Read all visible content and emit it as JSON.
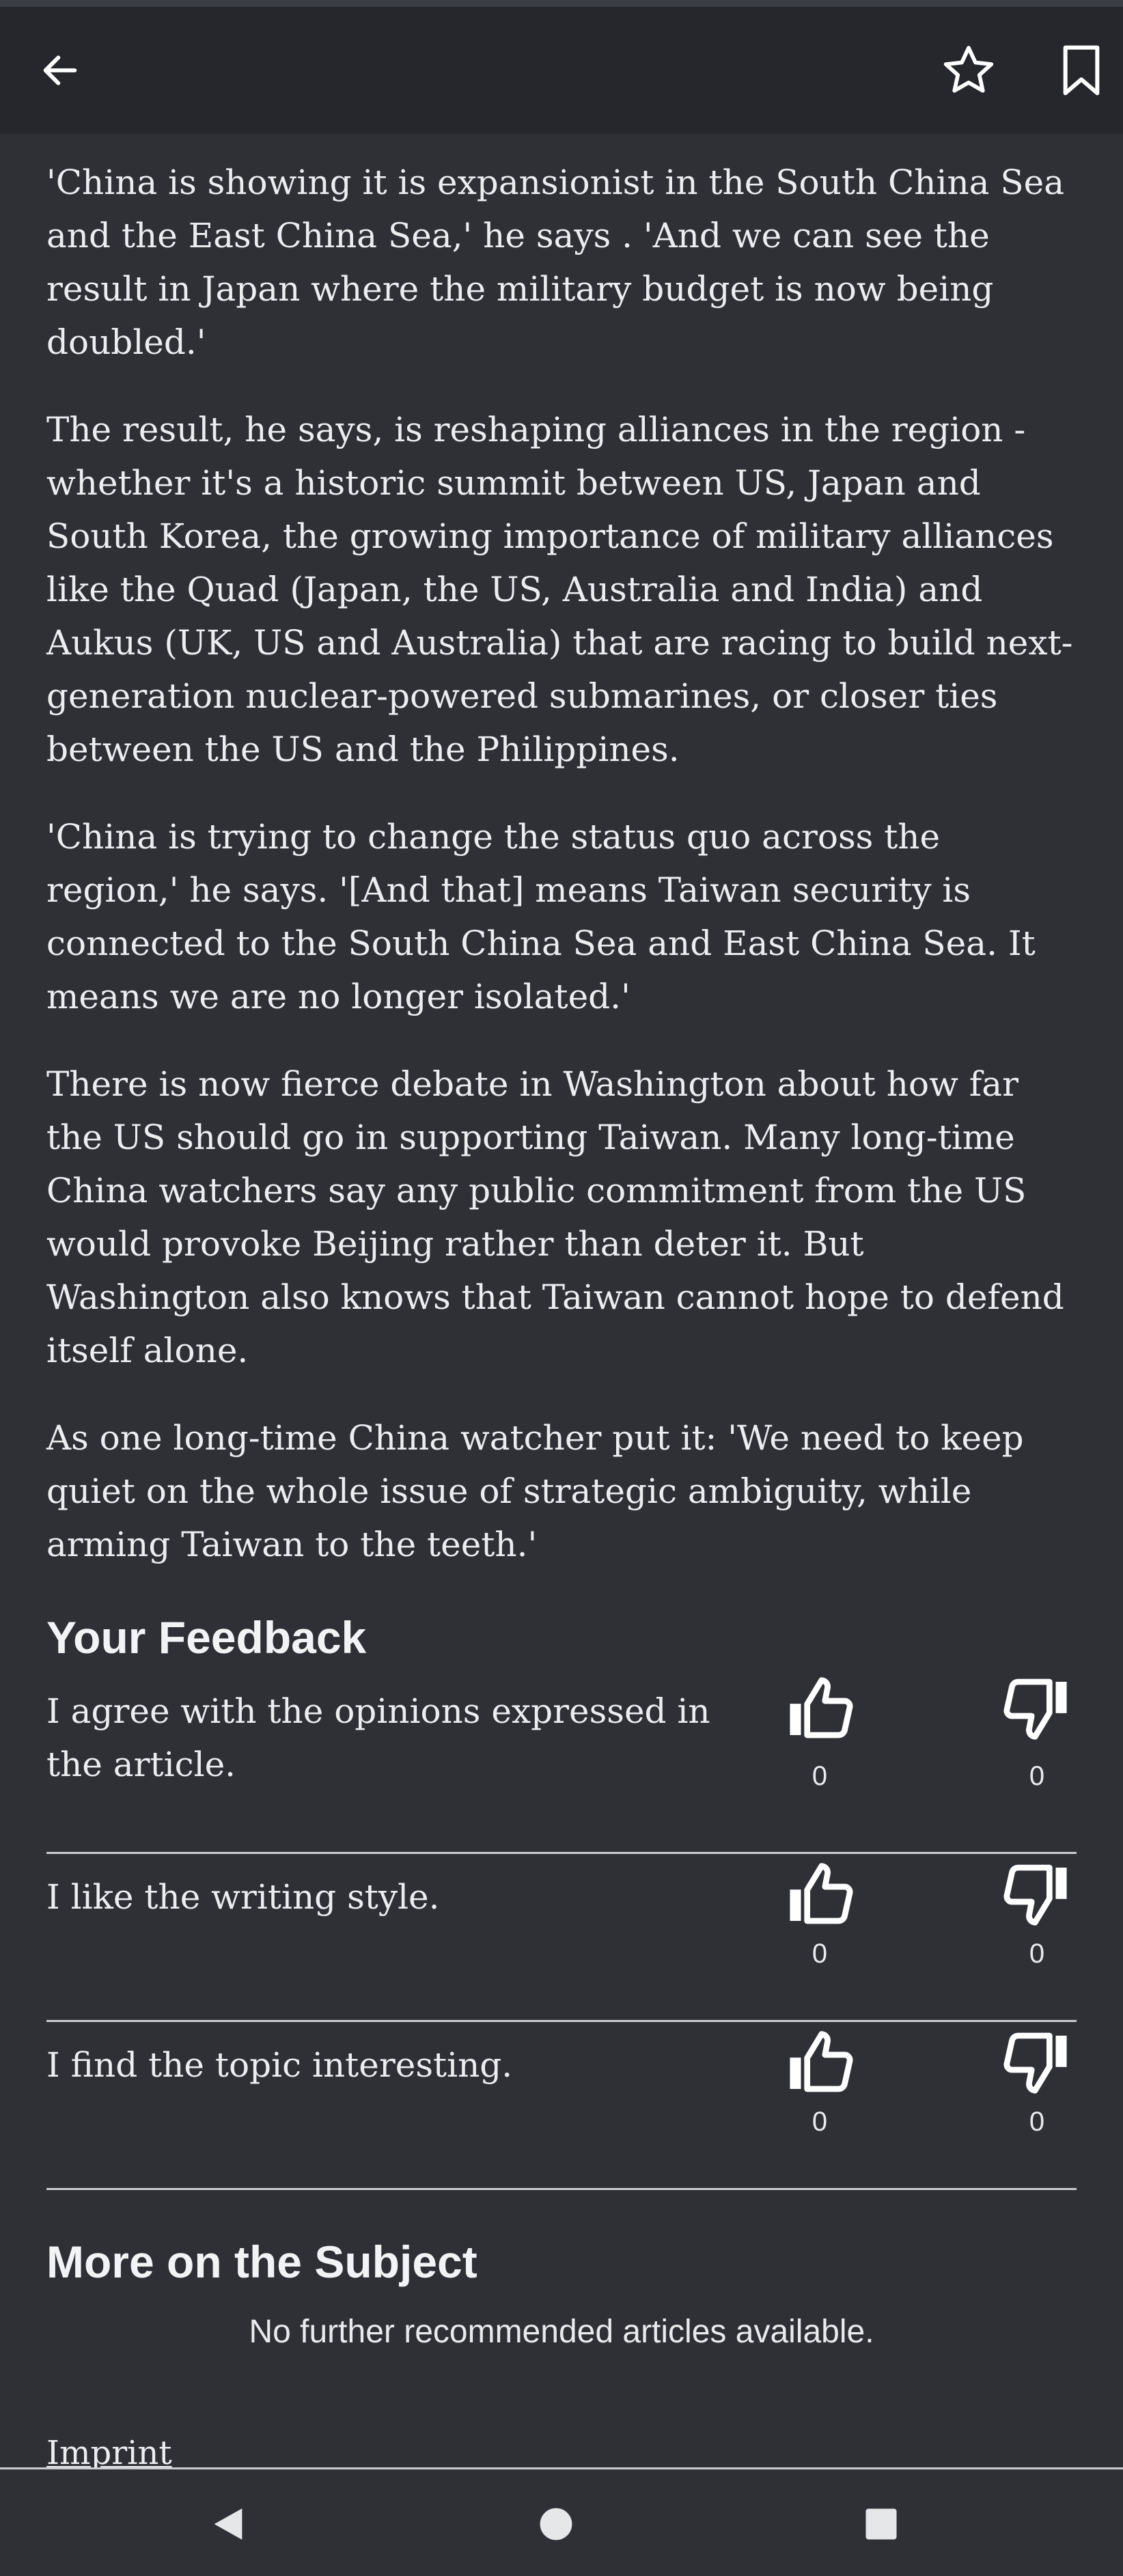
{
  "toolbar": {
    "back_icon": "arrow-left-icon",
    "favorite_icon": "star-outline-icon",
    "bookmark_icon": "bookmark-outline-icon"
  },
  "article": {
    "paragraphs": [
      "'China is showing it is expansionist in the South China Sea and the East China Sea,' he says . 'And we can see the result in Japan where the military budget is now being doubled.'",
      "The result, he says, is reshaping alliances in the region - whether it's a historic summit between  US, Japan and South Korea, the growing importance of military alliances like the Quad (Japan, the US, Australia and India) and Aukus (UK, US and Australia) that are racing to build next-generation nuclear-powered submarines, or closer ties between the US and the Philippines.",
      "'China is trying to change the status quo across the region,' he says. '[And that] means Taiwan security is connected to the South China Sea and East China Sea. It means we are no longer isolated.'",
      "There is now fierce debate in Washington about how far the US should go in supporting Taiwan. Many long-time China watchers say any public commitment from the US would provoke Beijing rather than deter it. But Washington also knows that Taiwan cannot hope to defend itself alone.",
      "As one long-time China watcher put it: 'We need to keep quiet on the whole issue of strategic ambiguity, while arming Taiwan to the teeth.'"
    ]
  },
  "feedback": {
    "title": "Your Feedback",
    "items": [
      {
        "text": "I agree with the opinions expressed in the article.",
        "likes": "0",
        "dislikes": "0"
      },
      {
        "text": "I like the writing style.",
        "likes": "0",
        "dislikes": "0"
      },
      {
        "text": "I find the topic interesting.",
        "likes": "0",
        "dislikes": "0"
      }
    ]
  },
  "more": {
    "title": "More on the Subject",
    "empty_message": "No further recommended articles available."
  },
  "footer": {
    "imprint_label": "Imprint"
  },
  "system_nav": {
    "back_icon": "triangle-back-icon",
    "home_icon": "circle-home-icon",
    "recents_icon": "square-recents-icon"
  }
}
